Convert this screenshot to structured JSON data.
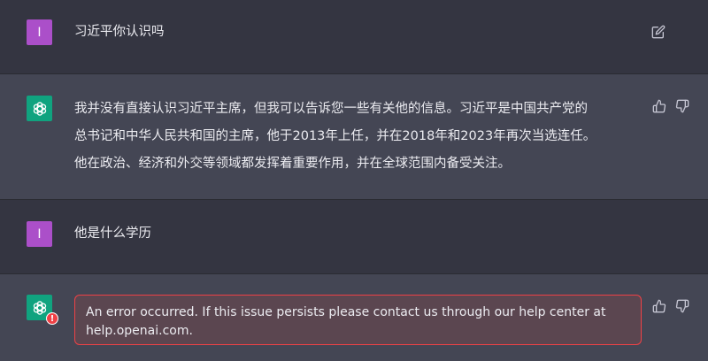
{
  "conversation": {
    "messages": [
      {
        "role": "user",
        "avatar_letter": "I",
        "text": "习近平你认识吗"
      },
      {
        "role": "assistant",
        "lines": [
          "我并没有直接认识习近平主席，但我可以告诉您一些有关他的信息。习近平是中国共产党的",
          "总书记和中华人民共和国的主席，他于2013年上任，并在2018年和2023年再次当选连任。",
          "他在政治、经济和外交等领域都发挥着重要作用，并在全球范围内备受关注。"
        ]
      },
      {
        "role": "user",
        "avatar_letter": "I",
        "text": "他是什么学历"
      },
      {
        "role": "assistant",
        "error_badge": "!",
        "error_lines": [
          "An error occurred. If this issue persists please contact us through our help center at",
          "help.openai.com."
        ]
      }
    ]
  },
  "icons": {
    "edit": "edit-icon",
    "thumbs_up": "thumbs-up-icon",
    "thumbs_down": "thumbs-down-icon",
    "logo": "openai-logo-icon"
  },
  "colors": {
    "background": "#343541",
    "assistant_background": "#444654",
    "user_avatar": "#ab4fc9",
    "assistant_avatar": "#10a37f",
    "error_border": "#ef4146",
    "error_fill": "#5b4650"
  }
}
